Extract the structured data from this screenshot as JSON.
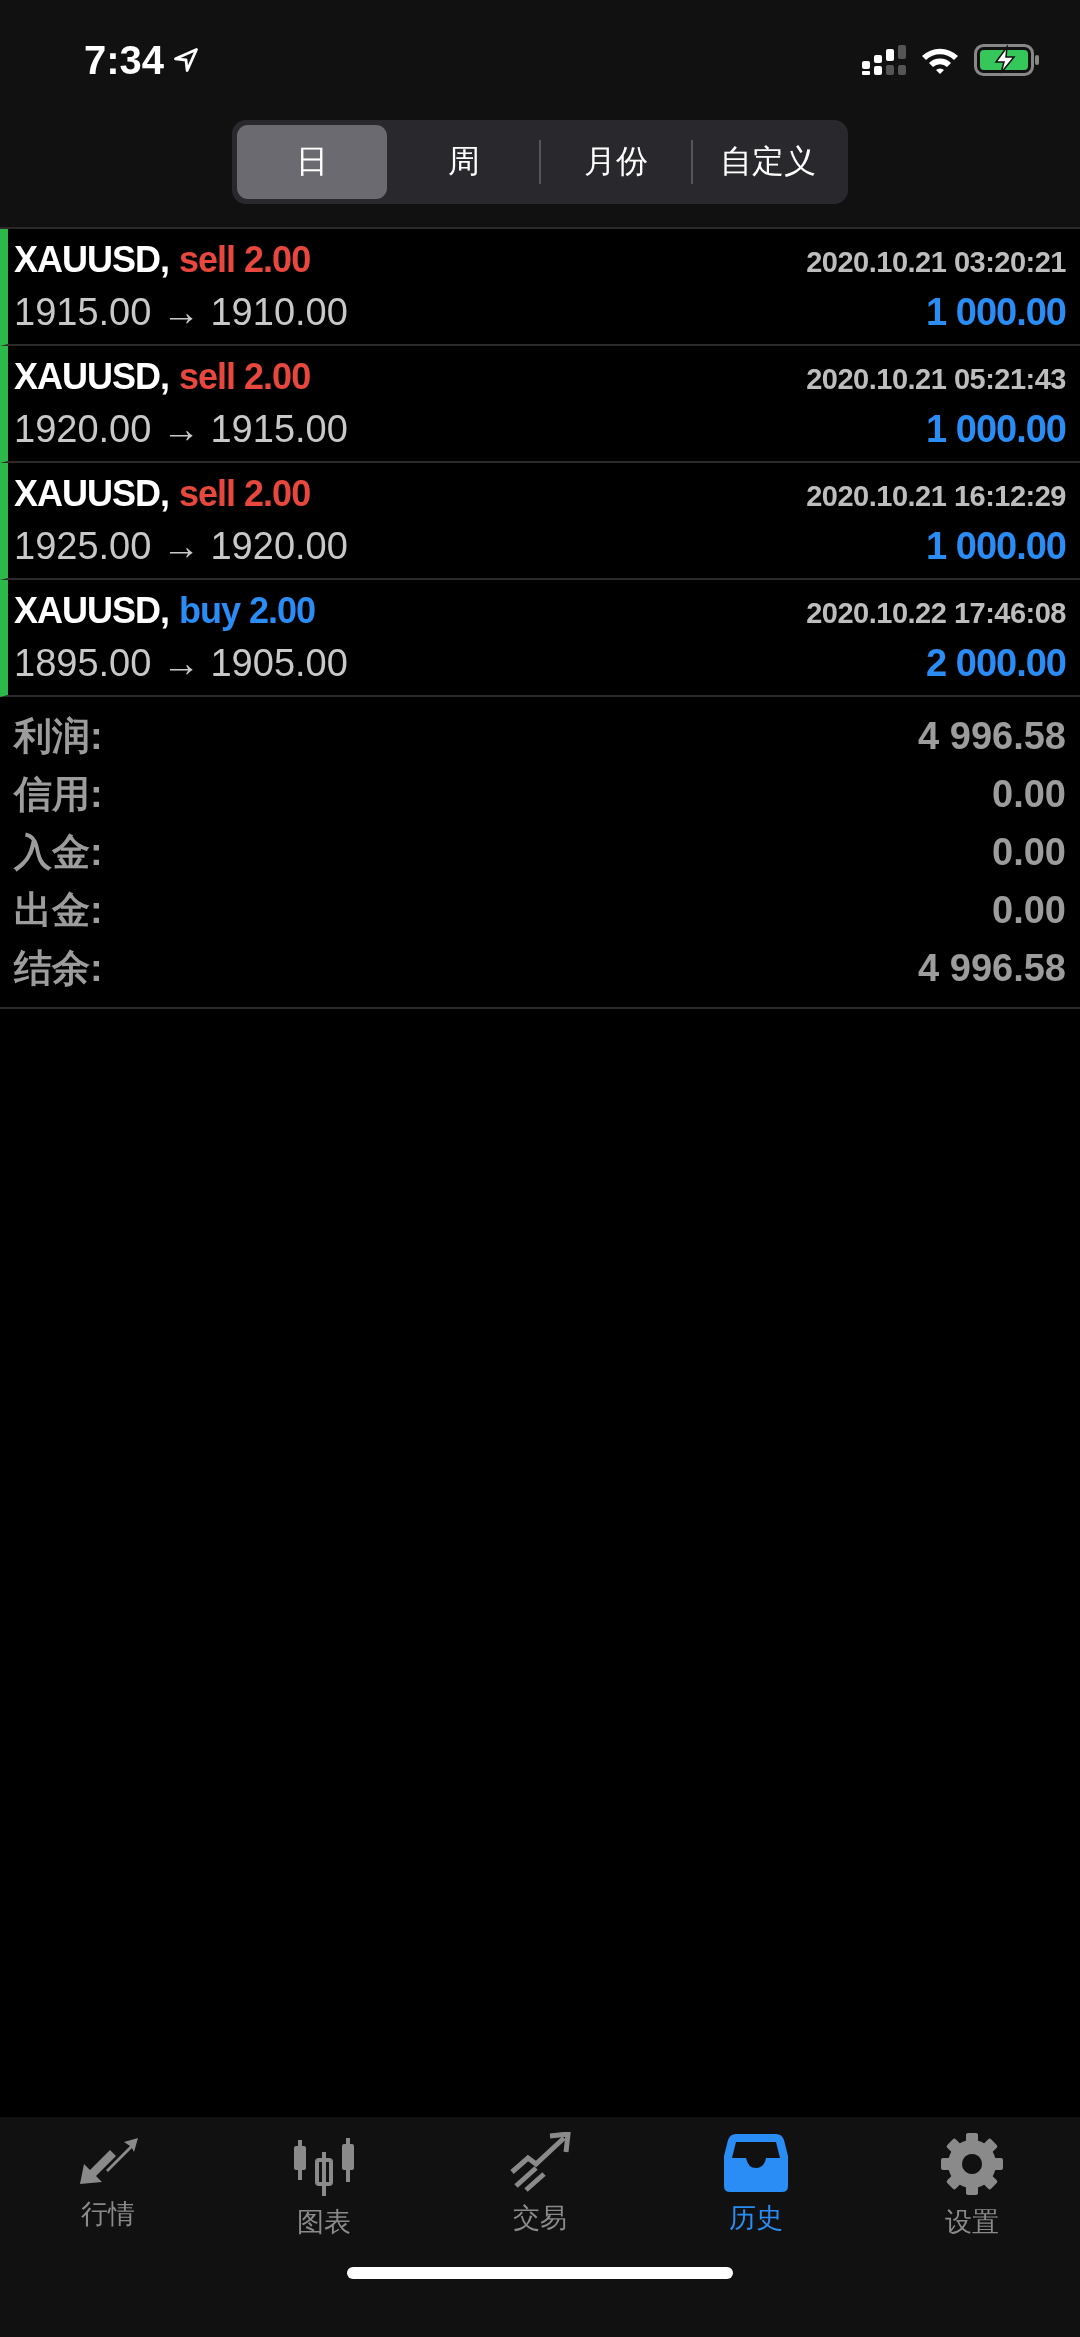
{
  "status_bar": {
    "time": "7:34"
  },
  "period_tabs": [
    {
      "label": "日",
      "selected": true
    },
    {
      "label": "周",
      "selected": false
    },
    {
      "label": "月份",
      "selected": false
    },
    {
      "label": "自定义",
      "selected": false
    }
  ],
  "trades": [
    {
      "symbol": "XAUUSD,",
      "side": "sell",
      "volume": "2.00",
      "prices": "1915.00 → 1910.00",
      "time": "2020.10.21 03:20:21",
      "profit": "1 000.00"
    },
    {
      "symbol": "XAUUSD,",
      "side": "sell",
      "volume": "2.00",
      "prices": "1920.00 → 1915.00",
      "time": "2020.10.21 05:21:43",
      "profit": "1 000.00"
    },
    {
      "symbol": "XAUUSD,",
      "side": "sell",
      "volume": "2.00",
      "prices": "1925.00 → 1920.00",
      "time": "2020.10.21 16:12:29",
      "profit": "1 000.00"
    },
    {
      "symbol": "XAUUSD,",
      "side": "buy",
      "volume": "2.00",
      "prices": "1895.00 → 1905.00",
      "time": "2020.10.22 17:46:08",
      "profit": "2 000.00"
    }
  ],
  "summary": [
    {
      "label": "利润:",
      "value": "4 996.58"
    },
    {
      "label": "信用:",
      "value": "0.00"
    },
    {
      "label": "入金:",
      "value": "0.00"
    },
    {
      "label": "出金:",
      "value": "0.00"
    },
    {
      "label": "结余:",
      "value": "4 996.58"
    }
  ],
  "tab_bar": [
    {
      "label": "行情",
      "selected": false
    },
    {
      "label": "图表",
      "selected": false
    },
    {
      "label": "交易",
      "selected": false
    },
    {
      "label": "历史",
      "selected": true
    },
    {
      "label": "设置",
      "selected": false
    }
  ]
}
